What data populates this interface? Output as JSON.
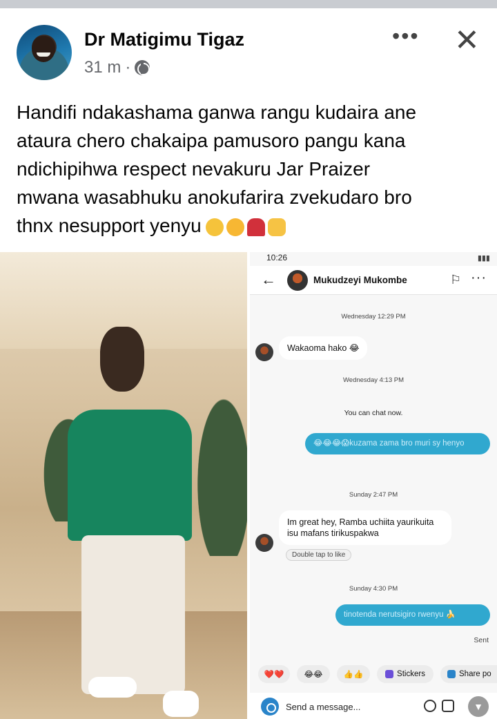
{
  "post": {
    "author": "Dr Matigimu Tigaz",
    "time": "31 m",
    "separator": "·",
    "more_icon": "•••",
    "close_icon": "✕",
    "lines": [
      "Handifi ndakashama ganwa rangu kudaira ane",
      "ataura chero chakaipa pamusoro pangu kana",
      "ndichipihwa respect nevakuru Jar Praizer",
      "mwana wasabhuku anokufarira zvekudaro bro",
      "thnx nesupport yenyu"
    ],
    "emoji_icons": [
      "crying-face",
      "smiling-face-with-hearts",
      "dancer",
      "clapping-hands"
    ]
  },
  "chat": {
    "status_time": "10:26",
    "contact_name": "Mukudzeyi Mukombe",
    "back_icon": "←",
    "flag_icon": "⚐",
    "more_icon": "···",
    "messages": {
      "ts1": "Wednesday 12:29 PM",
      "in1": "Wakaoma hako 😂",
      "ts2": "Wednesday 4:13 PM",
      "system": "You can chat now.",
      "out1": "😂😂😂😱kuzama zama bro muri sy henyo",
      "ts3": "Sunday 2:47 PM",
      "in2": "Im great hey, Ramba uchiita yaurikuita isu mafans tirikuspakwa",
      "like_hint": "Double tap to like",
      "ts4": "Sunday 4:30 PM",
      "out2": "tinotenda nerutsigiro rwenyu 🍌",
      "sent": "Sent"
    },
    "quick_reactions": [
      "❤️❤️",
      "😂😂",
      "👍👍",
      "Stickers",
      "Share po"
    ],
    "composer_placeholder": "Send a message..."
  },
  "colors": {
    "outgoing_bubble": "#30a8cf",
    "accent": "#2a84c9"
  }
}
